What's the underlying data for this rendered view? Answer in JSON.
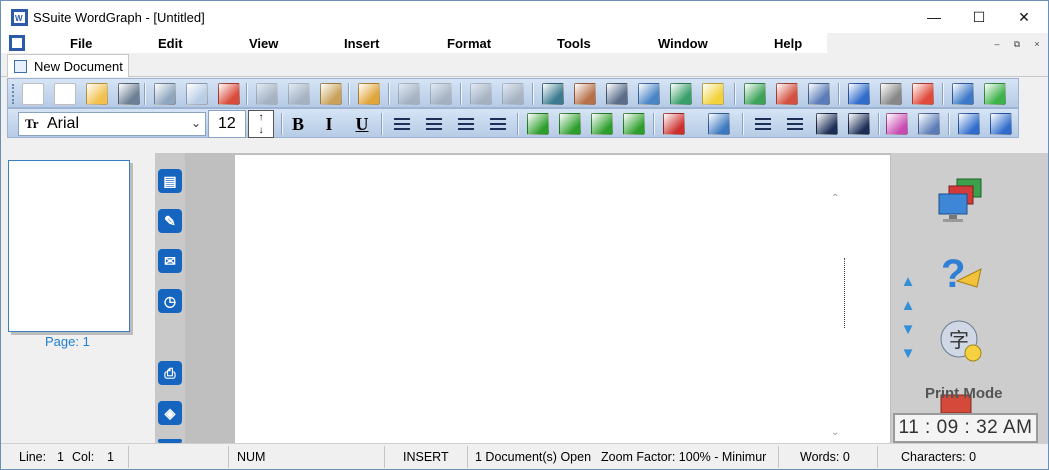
{
  "window": {
    "title": "SSuite WordGraph - [Untitled]",
    "controls": {
      "minimize": "—",
      "maximize": "☐",
      "close": "✕"
    }
  },
  "menu": {
    "items": [
      "File",
      "Edit",
      "View",
      "Insert",
      "Format",
      "Tools",
      "Window",
      "Help"
    ],
    "mdi_controls": [
      "–",
      "⧉",
      "×"
    ]
  },
  "tab": {
    "label": "New Document"
  },
  "toolbar1": {
    "buttons": [
      {
        "name": "new-document",
        "color": "#ffffff"
      },
      {
        "name": "copy-document",
        "color": "#ffffff"
      },
      {
        "name": "open-folder",
        "color": "#f2c14e"
      },
      {
        "name": "save-disk",
        "color": "#6d7f94"
      },
      {
        "name": "print",
        "color": "#8fa6bf"
      },
      {
        "name": "print-preview",
        "color": "#b8cde4"
      },
      {
        "name": "spell-check",
        "color": "#d94b3b"
      },
      {
        "name": "cut",
        "color": "#7a7a7a",
        "disabled": true
      },
      {
        "name": "copy",
        "color": "#7a7a7a",
        "disabled": true
      },
      {
        "name": "paste",
        "color": "#c9a15a"
      },
      {
        "name": "highlighter",
        "color": "#e2a53a"
      },
      {
        "name": "undo",
        "color": "#7a7a7a",
        "disabled": true
      },
      {
        "name": "redo",
        "color": "#7a7a7a",
        "disabled": true
      },
      {
        "name": "zoom-in",
        "color": "#7a7a7a",
        "disabled": true
      },
      {
        "name": "zoom-out",
        "color": "#7a7a7a",
        "disabled": true
      },
      {
        "name": "database",
        "color": "#3b7a8f"
      },
      {
        "name": "insert-picture",
        "color": "#b7714a"
      },
      {
        "name": "camera",
        "color": "#5a6e8a"
      },
      {
        "name": "insert-table",
        "color": "#4a85c7"
      },
      {
        "name": "insert-chart",
        "color": "#3aa06b"
      },
      {
        "name": "formula",
        "color": "#f1d23c"
      },
      {
        "name": "document-compare",
        "color": "#3ea35a"
      },
      {
        "name": "plugins",
        "color": "#d34f3f"
      },
      {
        "name": "email",
        "color": "#5a7cb8"
      },
      {
        "name": "back-arrow",
        "color": "#2f6ccc"
      },
      {
        "name": "clock",
        "color": "#888888"
      },
      {
        "name": "calendar",
        "color": "#e04a3a"
      },
      {
        "name": "exit",
        "color": "#3d79c8"
      },
      {
        "name": "help",
        "color": "#3fb34b"
      }
    ]
  },
  "toolbar2": {
    "font_name": "Arial",
    "font_icon": "Tr",
    "font_size": "12",
    "format_buttons": [
      "B",
      "I",
      "U"
    ],
    "buttons": [
      {
        "name": "align-left",
        "color": "#1c2f57"
      },
      {
        "name": "align-center",
        "color": "#1c2f57"
      },
      {
        "name": "align-right",
        "color": "#1c2f57"
      },
      {
        "name": "align-justify",
        "color": "#1c2f57"
      },
      {
        "name": "indent-left",
        "color": "#2d9e2d"
      },
      {
        "name": "outdent",
        "color": "#2d9e2d"
      },
      {
        "name": "indent",
        "color": "#2d9e2d"
      },
      {
        "name": "indent-right",
        "color": "#2d9e2d"
      },
      {
        "name": "stop-sign",
        "color": "#cc2d2d"
      },
      {
        "name": "monitor",
        "color": "#3b78c0"
      },
      {
        "name": "numbered-list",
        "color": "#1c2f57"
      },
      {
        "name": "bulleted-list",
        "color": "#1c2f57"
      },
      {
        "name": "superscript",
        "color": "#1c2f57"
      },
      {
        "name": "subscript",
        "color": "#1c2f57"
      },
      {
        "name": "page-color",
        "color": "#c94ab0"
      },
      {
        "name": "text-box",
        "color": "#5a7cb8"
      },
      {
        "name": "page-up",
        "color": "#2f6ccc"
      },
      {
        "name": "page-next",
        "color": "#2f6ccc"
      }
    ]
  },
  "pages": {
    "label": "Page: 1"
  },
  "sidebar": {
    "icons": [
      "document-icon",
      "edit-icon",
      "chat-icon",
      "clock-icon",
      "printer-icon",
      "globe-icon"
    ]
  },
  "right_panel": {
    "print_mode": "Print Mode",
    "clock": "11 : 09 : 32 AM"
  },
  "status": {
    "line_label": "Line:",
    "line_value": "1",
    "col_label": "Col:",
    "col_value": "1",
    "num": "NUM",
    "insert": "INSERT",
    "documents_open": "1 Document(s) Open",
    "zoom": "Zoom Factor: 100% - Minimur",
    "words": "Words: 0",
    "characters": "Characters: 0"
  }
}
